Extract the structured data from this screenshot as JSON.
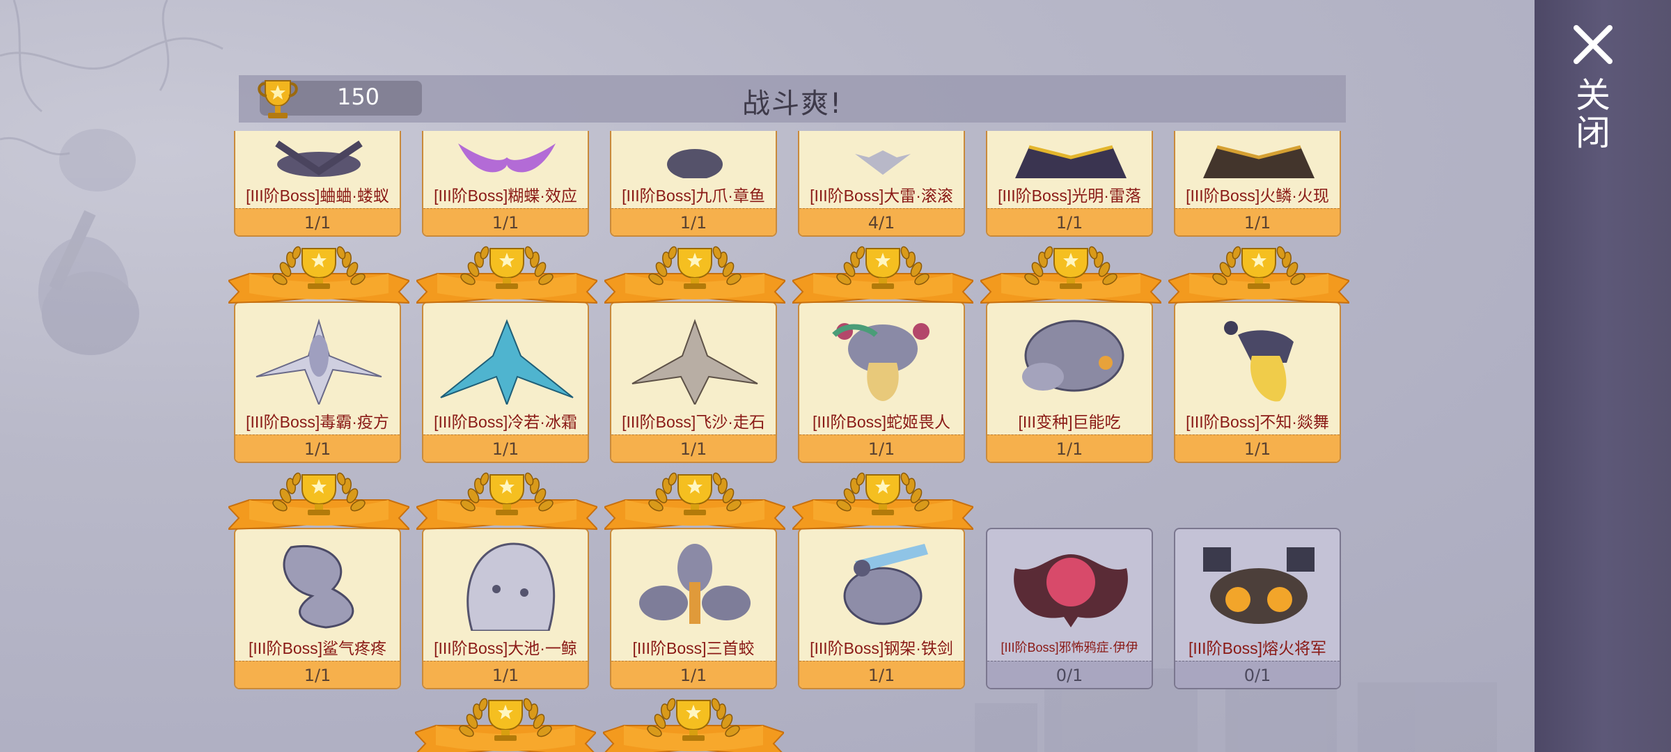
{
  "header": {
    "title": "战斗爽!",
    "score": "150"
  },
  "close": {
    "label": "关闭"
  },
  "colors": {
    "accent_orange": "#f6b04c",
    "name_red": "#8a1a16",
    "locked_gray": "#c4c2d6",
    "panel_purple": "#4d4866"
  },
  "icons": [
    "trophy-icon",
    "close-icon",
    "laurel-trophy-icon"
  ],
  "rows": [
    [
      {
        "name": "[III阶Boss]蛐蛐·蝼蚁",
        "progress": "1/1",
        "unlocked": true
      },
      {
        "name": "[III阶Boss]糊蝶·效应",
        "progress": "1/1",
        "unlocked": true
      },
      {
        "name": "[III阶Boss]九爪·章鱼",
        "progress": "1/1",
        "unlocked": true
      },
      {
        "name": "[III阶Boss]大雷·滚滚",
        "progress": "4/1",
        "unlocked": true
      },
      {
        "name": "[III阶Boss]光明·雷落",
        "progress": "1/1",
        "unlocked": true
      },
      {
        "name": "[III阶Boss]火鳞·火现",
        "progress": "1/1",
        "unlocked": true
      }
    ],
    [
      {
        "name": "[III阶Boss]毒霸·疫方",
        "progress": "1/1",
        "unlocked": true
      },
      {
        "name": "[III阶Boss]冷若·冰霜",
        "progress": "1/1",
        "unlocked": true
      },
      {
        "name": "[III阶Boss]飞沙·走石",
        "progress": "1/1",
        "unlocked": true
      },
      {
        "name": "[III阶Boss]蛇姬畏人",
        "progress": "1/1",
        "unlocked": true
      },
      {
        "name": "[III变种]巨能吃",
        "progress": "1/1",
        "unlocked": true
      },
      {
        "name": "[III阶Boss]不知·燚舞",
        "progress": "1/1",
        "unlocked": true
      }
    ],
    [
      {
        "name": "[III阶Boss]鲨气疼疼",
        "progress": "1/1",
        "unlocked": true
      },
      {
        "name": "[III阶Boss]大池·一鲸",
        "progress": "1/1",
        "unlocked": true
      },
      {
        "name": "[III阶Boss]三首蛟",
        "progress": "1/1",
        "unlocked": true
      },
      {
        "name": "[III阶Boss]钢架·铁剑",
        "progress": "1/1",
        "unlocked": true
      },
      {
        "name": "[III阶Boss]邪怖鸦症·伊伊",
        "progress": "0/1",
        "unlocked": false
      },
      {
        "name": "[III阶Boss]熔火将军",
        "progress": "0/1",
        "unlocked": false
      }
    ]
  ]
}
